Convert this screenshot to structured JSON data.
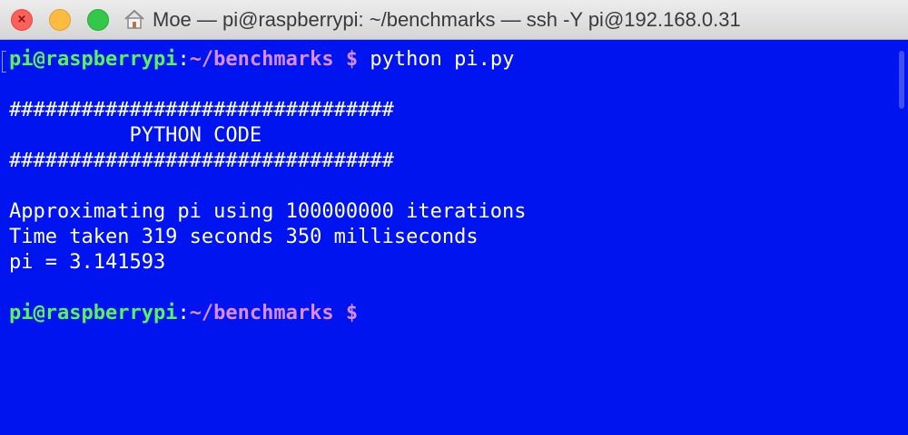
{
  "window": {
    "title": "Moe — pi@raspberrypi: ~/benchmarks — ssh -Y pi@192.168.0.31",
    "title_icon": "home-icon"
  },
  "prompt": {
    "user_host": "pi@raspberrypi",
    "separator": ":",
    "path": "~/benchmarks $",
    "colors": {
      "user": "#5bf25b",
      "path": "#d98cf5",
      "text": "#ffffff",
      "background": "#0014f0"
    }
  },
  "terminal": {
    "command": " python pi.py",
    "lines": [
      "################################",
      "          PYTHON CODE",
      "################################",
      "Approximating pi using 100000000 iterations",
      "Time taken 319 seconds 350 milliseconds",
      "pi = 3.141593"
    ]
  }
}
